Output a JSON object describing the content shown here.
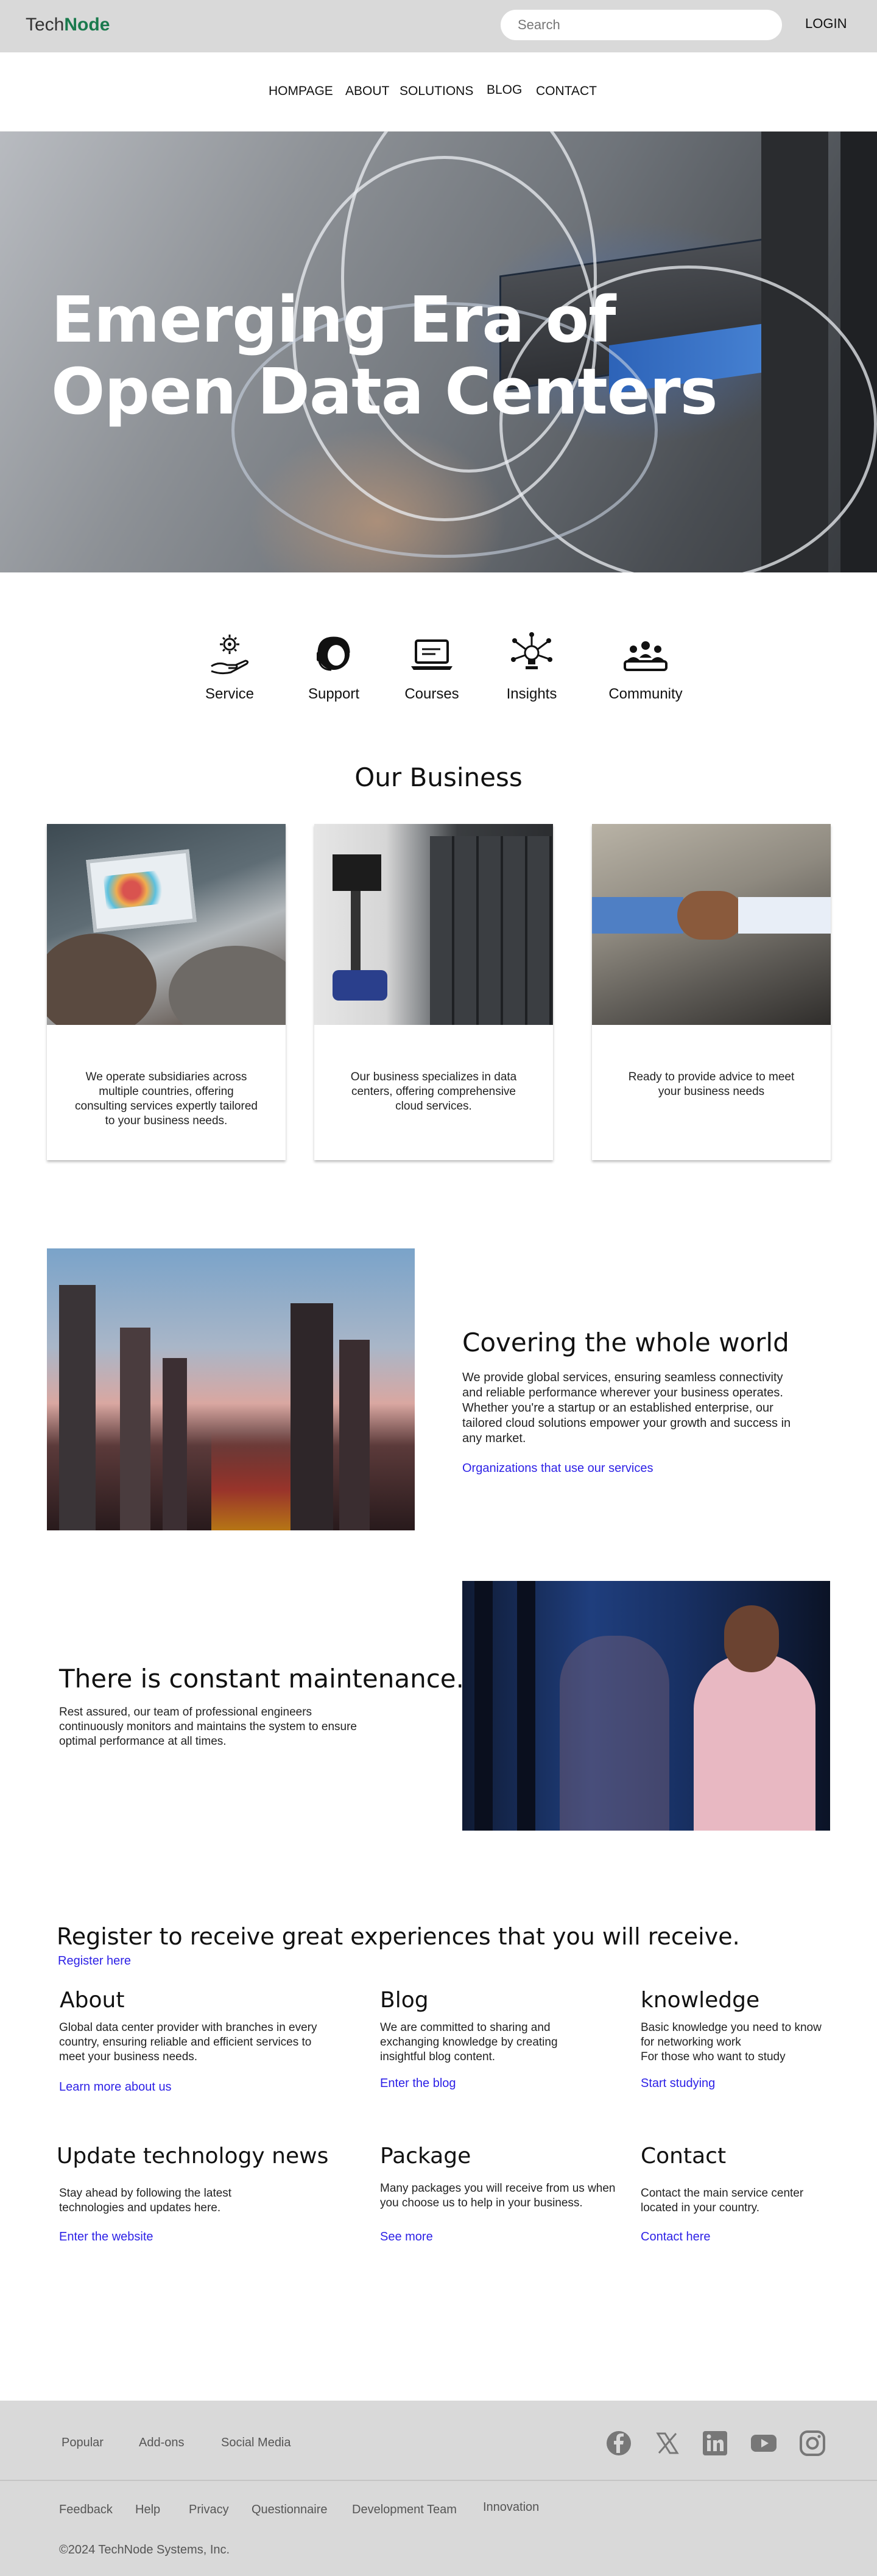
{
  "header": {
    "brand_part1": "Tech",
    "brand_part2": "Node",
    "search_placeholder": "Search",
    "login_label": "LOGIN"
  },
  "nav": {
    "items": [
      {
        "label": "HOMPAGE"
      },
      {
        "label": "ABOUT"
      },
      {
        "label": "SOLUTIONS"
      },
      {
        "label": "BLOG"
      },
      {
        "label": "CONTACT"
      }
    ]
  },
  "hero": {
    "title_line1": "Emerging Era of",
    "title_line2": "Open Data Centers"
  },
  "features": [
    {
      "label": "Service",
      "icon": "gear-hand-icon"
    },
    {
      "label": "Support",
      "icon": "headset-icon"
    },
    {
      "label": "Courses",
      "icon": "laptop-icon"
    },
    {
      "label": "Insights",
      "icon": "bulb-network-icon"
    },
    {
      "label": "Community",
      "icon": "people-group-icon"
    }
  ],
  "business": {
    "title": "Our Business",
    "cards": [
      {
        "text": "We operate subsidiaries across multiple countries, offering consulting services expertly tailored to your business needs."
      },
      {
        "text": "Our business specializes in data centers, offering comprehensive cloud services."
      },
      {
        "text": "Ready to provide advice to meet your business needs"
      }
    ]
  },
  "world": {
    "title": "Covering the whole world",
    "text": "We provide global services, ensuring seamless connectivity and reliable performance wherever your business operates. Whether you're a startup or an established enterprise, our tailored cloud solutions empower your growth and success in any market.",
    "link": "Organizations that use our services"
  },
  "maintenance": {
    "title": "There is constant maintenance.",
    "text": "Rest assured, our team of professional engineers continuously monitors and maintains the system to ensure optimal performance at all times."
  },
  "register": {
    "title": "Register to receive great experiences that you will receive.",
    "link": "Register here"
  },
  "info": {
    "about": {
      "title": "About",
      "text": "Global data center provider with branches in every country, ensuring reliable and efficient services to meet your business needs.",
      "link": "Learn more about us"
    },
    "blog": {
      "title": "Blog",
      "text": "We are committed to sharing and exchanging knowledge by creating insightful blog content.",
      "link": "Enter the blog"
    },
    "knowledge": {
      "title": "knowledge",
      "text1": "Basic knowledge you need to know for networking work",
      "text2": "For those who want to study",
      "link": "Start studying"
    },
    "news": {
      "title": "Update technology news",
      "text": "Stay ahead by following the latest technologies and updates here.",
      "link": "Enter the website"
    },
    "package": {
      "title": "Package",
      "text": "Many packages you will receive from us when you choose us to help in your business.",
      "link": "See more"
    },
    "contact": {
      "title": "Contact",
      "text": "Contact the main service center located in your country.",
      "link": "Contact here"
    }
  },
  "footer": {
    "row1": [
      "Popular",
      "Add-ons",
      "Social Media"
    ],
    "row2": [
      "Feedback",
      "Help",
      "Privacy",
      "Questionnaire",
      "Development Team",
      "Innovation"
    ],
    "social_icons": [
      "facebook-icon",
      "x-icon",
      "linkedin-icon",
      "youtube-icon",
      "instagram-icon"
    ],
    "copyright": "©2024 TechNode Systems, Inc."
  },
  "colors": {
    "brand_green": "#1a7a4d",
    "link_blue": "#2b1fe6",
    "bar_gray": "#d9d9d9"
  }
}
